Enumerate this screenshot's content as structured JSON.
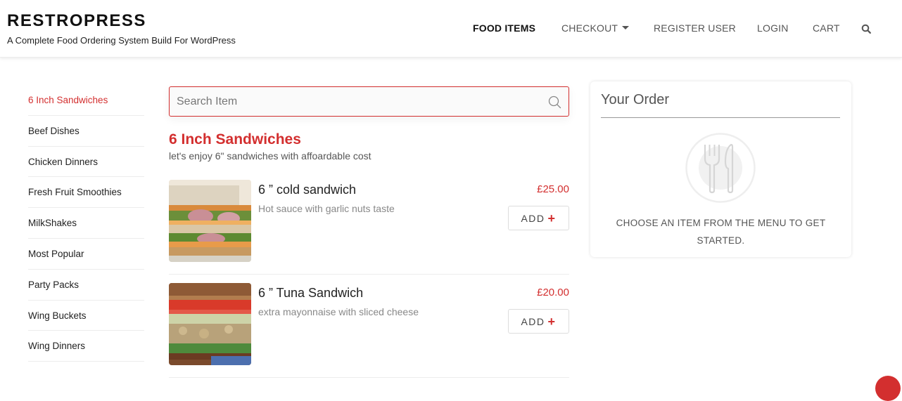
{
  "header": {
    "brand_title": "RESTROPRESS",
    "brand_tagline": "A Complete Food Ordering System Build For WordPress",
    "nav": [
      {
        "label": "FOOD ITEMS",
        "active": true
      },
      {
        "label": "CHECKOUT",
        "has_dropdown": true
      },
      {
        "label": "REGISTER USER"
      },
      {
        "label": "LOGIN"
      },
      {
        "label": "CART"
      }
    ],
    "search_icon": "search-icon"
  },
  "sidebar": {
    "categories": [
      {
        "label": "6 Inch Sandwiches",
        "active": true
      },
      {
        "label": "Beef Dishes"
      },
      {
        "label": "Chicken Dinners"
      },
      {
        "label": "Fresh Fruit Smoothies"
      },
      {
        "label": "MilkShakes"
      },
      {
        "label": "Most Popular"
      },
      {
        "label": "Party Packs"
      },
      {
        "label": "Wing Buckets"
      },
      {
        "label": "Wing Dinners"
      }
    ]
  },
  "search": {
    "placeholder": "Search Item",
    "value": ""
  },
  "category": {
    "heading": "6 Inch Sandwiches",
    "description": "let's enjoy 6\" sandwiches with affoardable cost"
  },
  "food_items": [
    {
      "title": "6 ” cold sandwich",
      "description": "Hot sauce with garlic nuts taste",
      "price": "£25.00",
      "add_label": "ADD",
      "add_icon": "+"
    },
    {
      "title": "6 ” Tuna Sandwich",
      "description": "extra mayonnaise with sliced cheese",
      "price": "£20.00",
      "add_label": "ADD",
      "add_icon": "+"
    }
  ],
  "order": {
    "title": "Your Order",
    "empty_icon": "fork-knife-icon",
    "empty_message": "CHOOSE AN ITEM FROM THE MENU TO GET STARTED."
  },
  "colors": {
    "accent": "#d32f2f",
    "text": "#222222",
    "muted": "#888888",
    "border": "#ececec"
  }
}
